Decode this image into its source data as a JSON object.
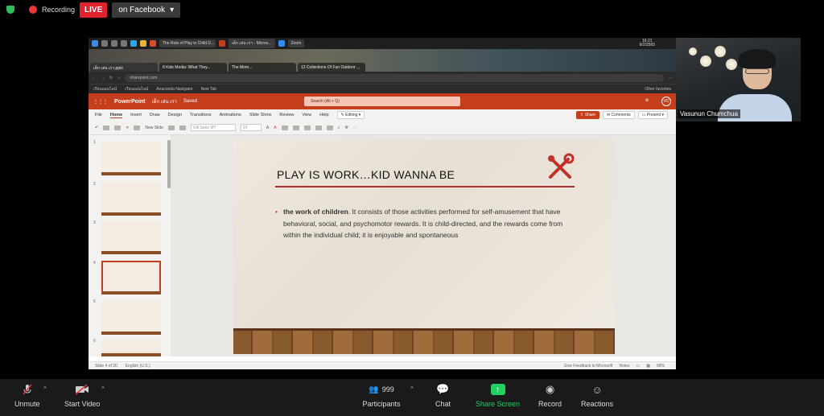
{
  "zoom_top": {
    "recording_label": "Recording",
    "live_label": "LIVE",
    "stream_target": "on Facebook"
  },
  "os_taskbar": {
    "tabs": [
      "The Role of Play in Child D...",
      "เด็ก เล่น เรา - Micros...",
      "Zoom"
    ],
    "clock_time": "16:21",
    "clock_date": "9/2/2565"
  },
  "browser": {
    "tabs": [
      "เด็ก เล่น เรา.pptx",
      "8 Kids Media: What They...",
      "The Mom...",
      "12 Collections Of Fun Outdoor ..."
    ],
    "address": "sharepoint.com",
    "bookmarks": [
      "เรียนออนไลน์",
      "เรียนออนไลน์",
      "Anaconda Navigator",
      "New Tab"
    ],
    "other_bookmarks": "Other favorites"
  },
  "powerpoint": {
    "app_name": "PowerPoint",
    "file_name": "เด็ก เล่น เรา",
    "file_status": "Saved",
    "search_placeholder": "Search (Alt + Q)",
    "user_initials": "VC",
    "ribbon_tabs": [
      "File",
      "Home",
      "Insert",
      "Draw",
      "Design",
      "Transitions",
      "Animations",
      "Slide Show",
      "Review",
      "View",
      "Help"
    ],
    "editing_label": "Editing",
    "share_label": "Share",
    "comments_label": "Comments",
    "present_label": "Present",
    "new_slide_label": "New Slide",
    "font_name": "Gill Sans MT",
    "font_size": "20",
    "thumbnail_numbers": [
      "1",
      "2",
      "3",
      "4",
      "5",
      "6"
    ],
    "status_left": "Slide 4 of 20",
    "status_lang": "English (U.S.)",
    "status_feedback": "Give Feedback to Microsoft",
    "status_notes": "Notes",
    "zoom_level": "68%"
  },
  "slide": {
    "title": "PLAY IS WORK…KID WANNA BE",
    "bullet_bold": "the work of children",
    "bullet_text": ". It consists of those activities performed for self-amusement that have behavioral, social, and psychomotor rewards. It is child-directed, and the rewards come from within the individual child; it is enjoyable and spontaneous"
  },
  "video": {
    "participant_name": "Vasunun Chumchua"
  },
  "zoom_controls": {
    "unmute": "Unmute",
    "start_video": "Start Video",
    "participants_count": "999",
    "participants": "Participants",
    "chat": "Chat",
    "share_screen": "Share Screen",
    "record": "Record",
    "reactions": "Reactions"
  },
  "colors": {
    "powerpoint_brand": "#c43e1c",
    "live_red": "#e0232e",
    "share_green": "#23d160"
  }
}
